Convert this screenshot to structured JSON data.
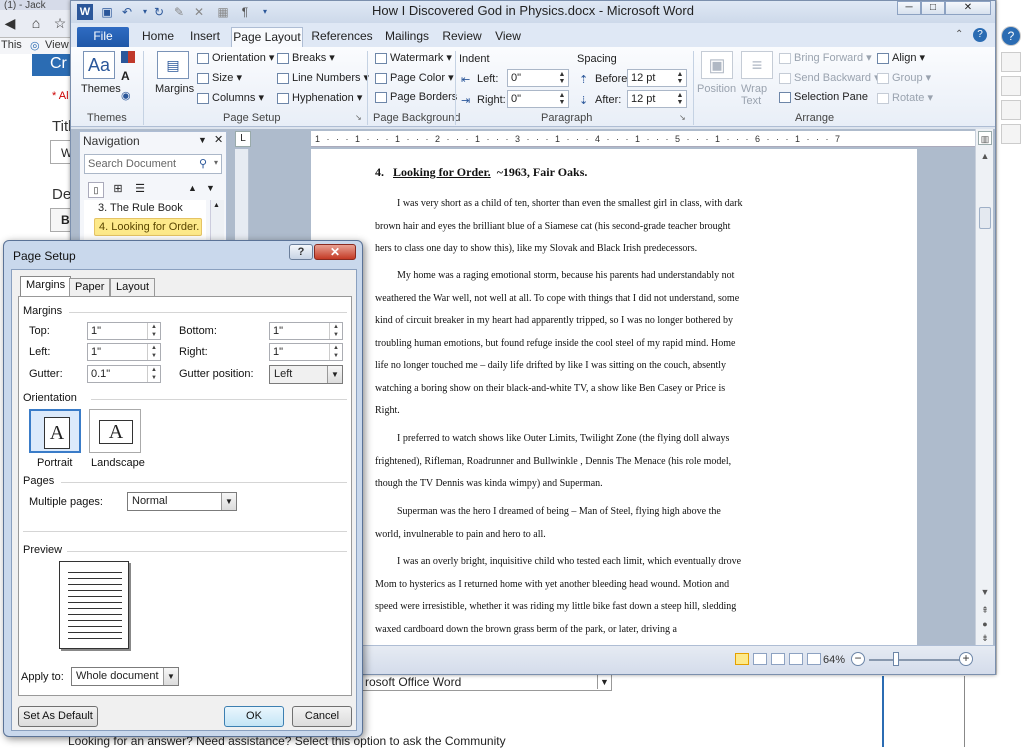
{
  "background": {
    "top_text": "(1) - Jack",
    "row2_left": "This",
    "row2_view": "View",
    "bottom_combo": "rosoft Office Word",
    "bottom_text": "Looking for an answer? Need assistance? Select this option to ask the Community",
    "left_peek": [
      "Cr",
      "* Al",
      "Titl",
      "W",
      "De",
      "B"
    ]
  },
  "word": {
    "title": "How I Discovered God in Physics.docx - Microsoft Word",
    "tabs": [
      "File",
      "Home",
      "Insert",
      "Page Layout",
      "References",
      "Mailings",
      "Review",
      "View"
    ],
    "ribbon": {
      "themes": {
        "button": "Themes",
        "group": "Themes"
      },
      "page_setup": {
        "margins": "Margins",
        "orientation": "Orientation",
        "size": "Size",
        "columns": "Columns",
        "breaks": "Breaks",
        "line_numbers": "Line Numbers",
        "hyphenation": "Hyphenation",
        "group": "Page Setup"
      },
      "page_background": {
        "watermark": "Watermark",
        "page_color": "Page Color",
        "page_borders": "Page Borders",
        "group": "Page Background"
      },
      "paragraph": {
        "indent": "Indent",
        "left_label": "Left:",
        "left_value": "0\"",
        "right_label": "Right:",
        "right_value": "0\"",
        "spacing": "Spacing",
        "before_label": "Before:",
        "before_value": "12 pt",
        "after_label": "After:",
        "after_value": "12 pt",
        "group": "Paragraph"
      },
      "arrange": {
        "position": "Position",
        "wrap_text": "Wrap Text",
        "bring_forward": "Bring Forward",
        "send_backward": "Send Backward",
        "selection_pane": "Selection Pane",
        "align": "Align",
        "group_btn": "Group",
        "rotate": "Rotate",
        "group": "Arrange"
      }
    },
    "navigation": {
      "title": "Navigation",
      "search_placeholder": "Search Document",
      "items": [
        "3. The Rule Book",
        "4. Looking for Order. ..."
      ]
    },
    "ruler": "1 · · · 1 · · · 1 · · · 2 · · · 1 · · · 3 · · · 1 · · · 4 · · · 1 · · · 5 · · · 1 · · · 6 · · · 1 · · · 7",
    "document": {
      "heading_number": "4.",
      "heading_title": "Looking for Order.",
      "heading_rest": "~1963, Fair Oaks.",
      "paragraphs": [
        "I was very short as a child of ten, shorter than even the smallest girl in class, with dark brown hair and eyes the brilliant blue of a Siamese cat (his second-grade teacher brought hers to class one day to show this), like my Slovak and Black Irish predecessors.",
        "My home was a raging emotional storm, because his parents had understandably not weathered the War well, not well at all. To cope with things that I did not understand, some kind of circuit breaker in my heart had apparently tripped, so I was no longer bothered by troubling human emotions, but found refuge inside the cool steel of my rapid mind. Home life no longer touched me – daily life drifted by like I was sitting on the couch, absently watching a boring show on their black-and-white TV, a show like Ben Casey or Price is Right.",
        "I preferred to watch shows like Outer Limits, Twilight Zone (the flying doll always frightened), Rifleman, Roadrunner and Bullwinkle , Dennis The Menace (his role model, though the TV Dennis was kinda wimpy) and Superman.",
        "Superman was the hero I dreamed of being – Man of Steel, flying high above the world, invulnerable to pain and hero to all.",
        "I was an overly bright, inquisitive child who tested each limit, which eventually drove Mom to hysterics as I returned home with yet another bleeding head wound. Motion and speed were irresistible, whether it was riding my little bike fast down a steep hill, sledding waxed cardboard down the brown grass berm of the park, or later, driving a"
      ]
    },
    "status": {
      "zoom": "64%"
    }
  },
  "dialog": {
    "title": "Page Setup",
    "tabs": [
      "Margins",
      "Paper",
      "Layout"
    ],
    "margins_section": "Margins",
    "top_label": "Top:",
    "top_value": "1\"",
    "bottom_label": "Bottom:",
    "bottom_value": "1\"",
    "left_label": "Left:",
    "left_value": "1\"",
    "right_label": "Right:",
    "right_value": "1\"",
    "gutter_label": "Gutter:",
    "gutter_value": "0.1\"",
    "gutter_pos_label": "Gutter position:",
    "gutter_pos_value": "Left",
    "orientation_section": "Orientation",
    "portrait": "Portrait",
    "landscape": "Landscape",
    "orientation_glyph": "A",
    "pages_section": "Pages",
    "multiple_pages_label": "Multiple pages:",
    "multiple_pages_value": "Normal",
    "preview_section": "Preview",
    "apply_to_label": "Apply to:",
    "apply_to_value": "Whole document",
    "set_default": "Set As Default",
    "ok": "OK",
    "cancel": "Cancel"
  }
}
